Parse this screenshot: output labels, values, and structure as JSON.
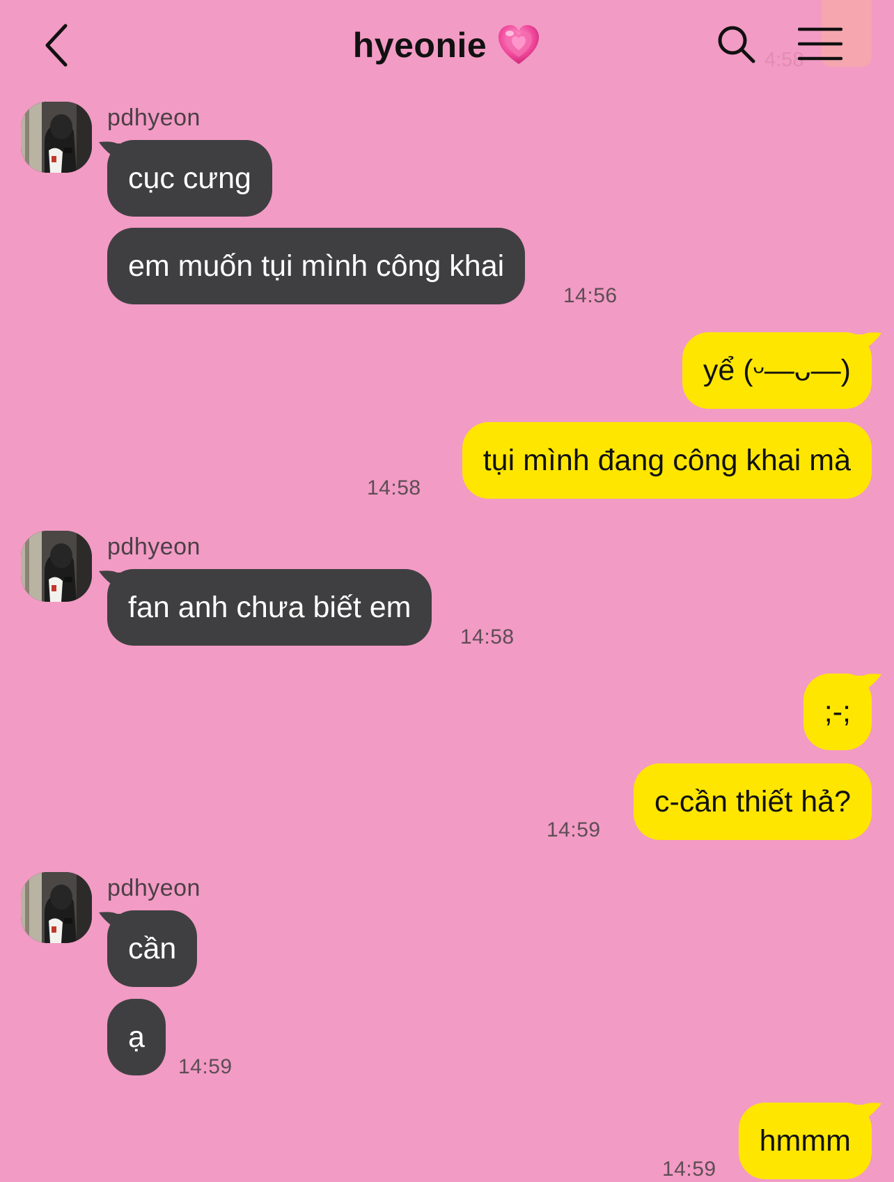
{
  "header": {
    "title": "hyeonie",
    "back_icon": "chevron-left-icon",
    "search_icon": "search-icon",
    "menu_icon": "hamburger-menu-icon",
    "title_emoji": "growing-heart-emoji",
    "ghost_time": "4:58"
  },
  "colors": {
    "background": "#f29bc4",
    "incoming_bubble": "#3f3f41",
    "outgoing_bubble": "#ffe600"
  },
  "messages": {
    "g1": {
      "sender": "pdhyeon",
      "m1": "cục cưng",
      "m2": "em muốn tụi mình công khai",
      "time": "14:56"
    },
    "g2": {
      "m1": "yể (ᵕ—ᴗ—)",
      "m2": "tụi mình đang công khai mà",
      "time": "14:58"
    },
    "g3": {
      "sender": "pdhyeon",
      "m1": "fan anh chưa biết em",
      "time": "14:58"
    },
    "g4": {
      "m1": ";-;",
      "m2": "c-cần thiết hả?",
      "time": "14:59"
    },
    "g5": {
      "sender": "pdhyeon",
      "m1": "cần",
      "m2": "ạ",
      "time": "14:59"
    },
    "g6": {
      "m1": "hmmm",
      "time": "14:59"
    }
  }
}
